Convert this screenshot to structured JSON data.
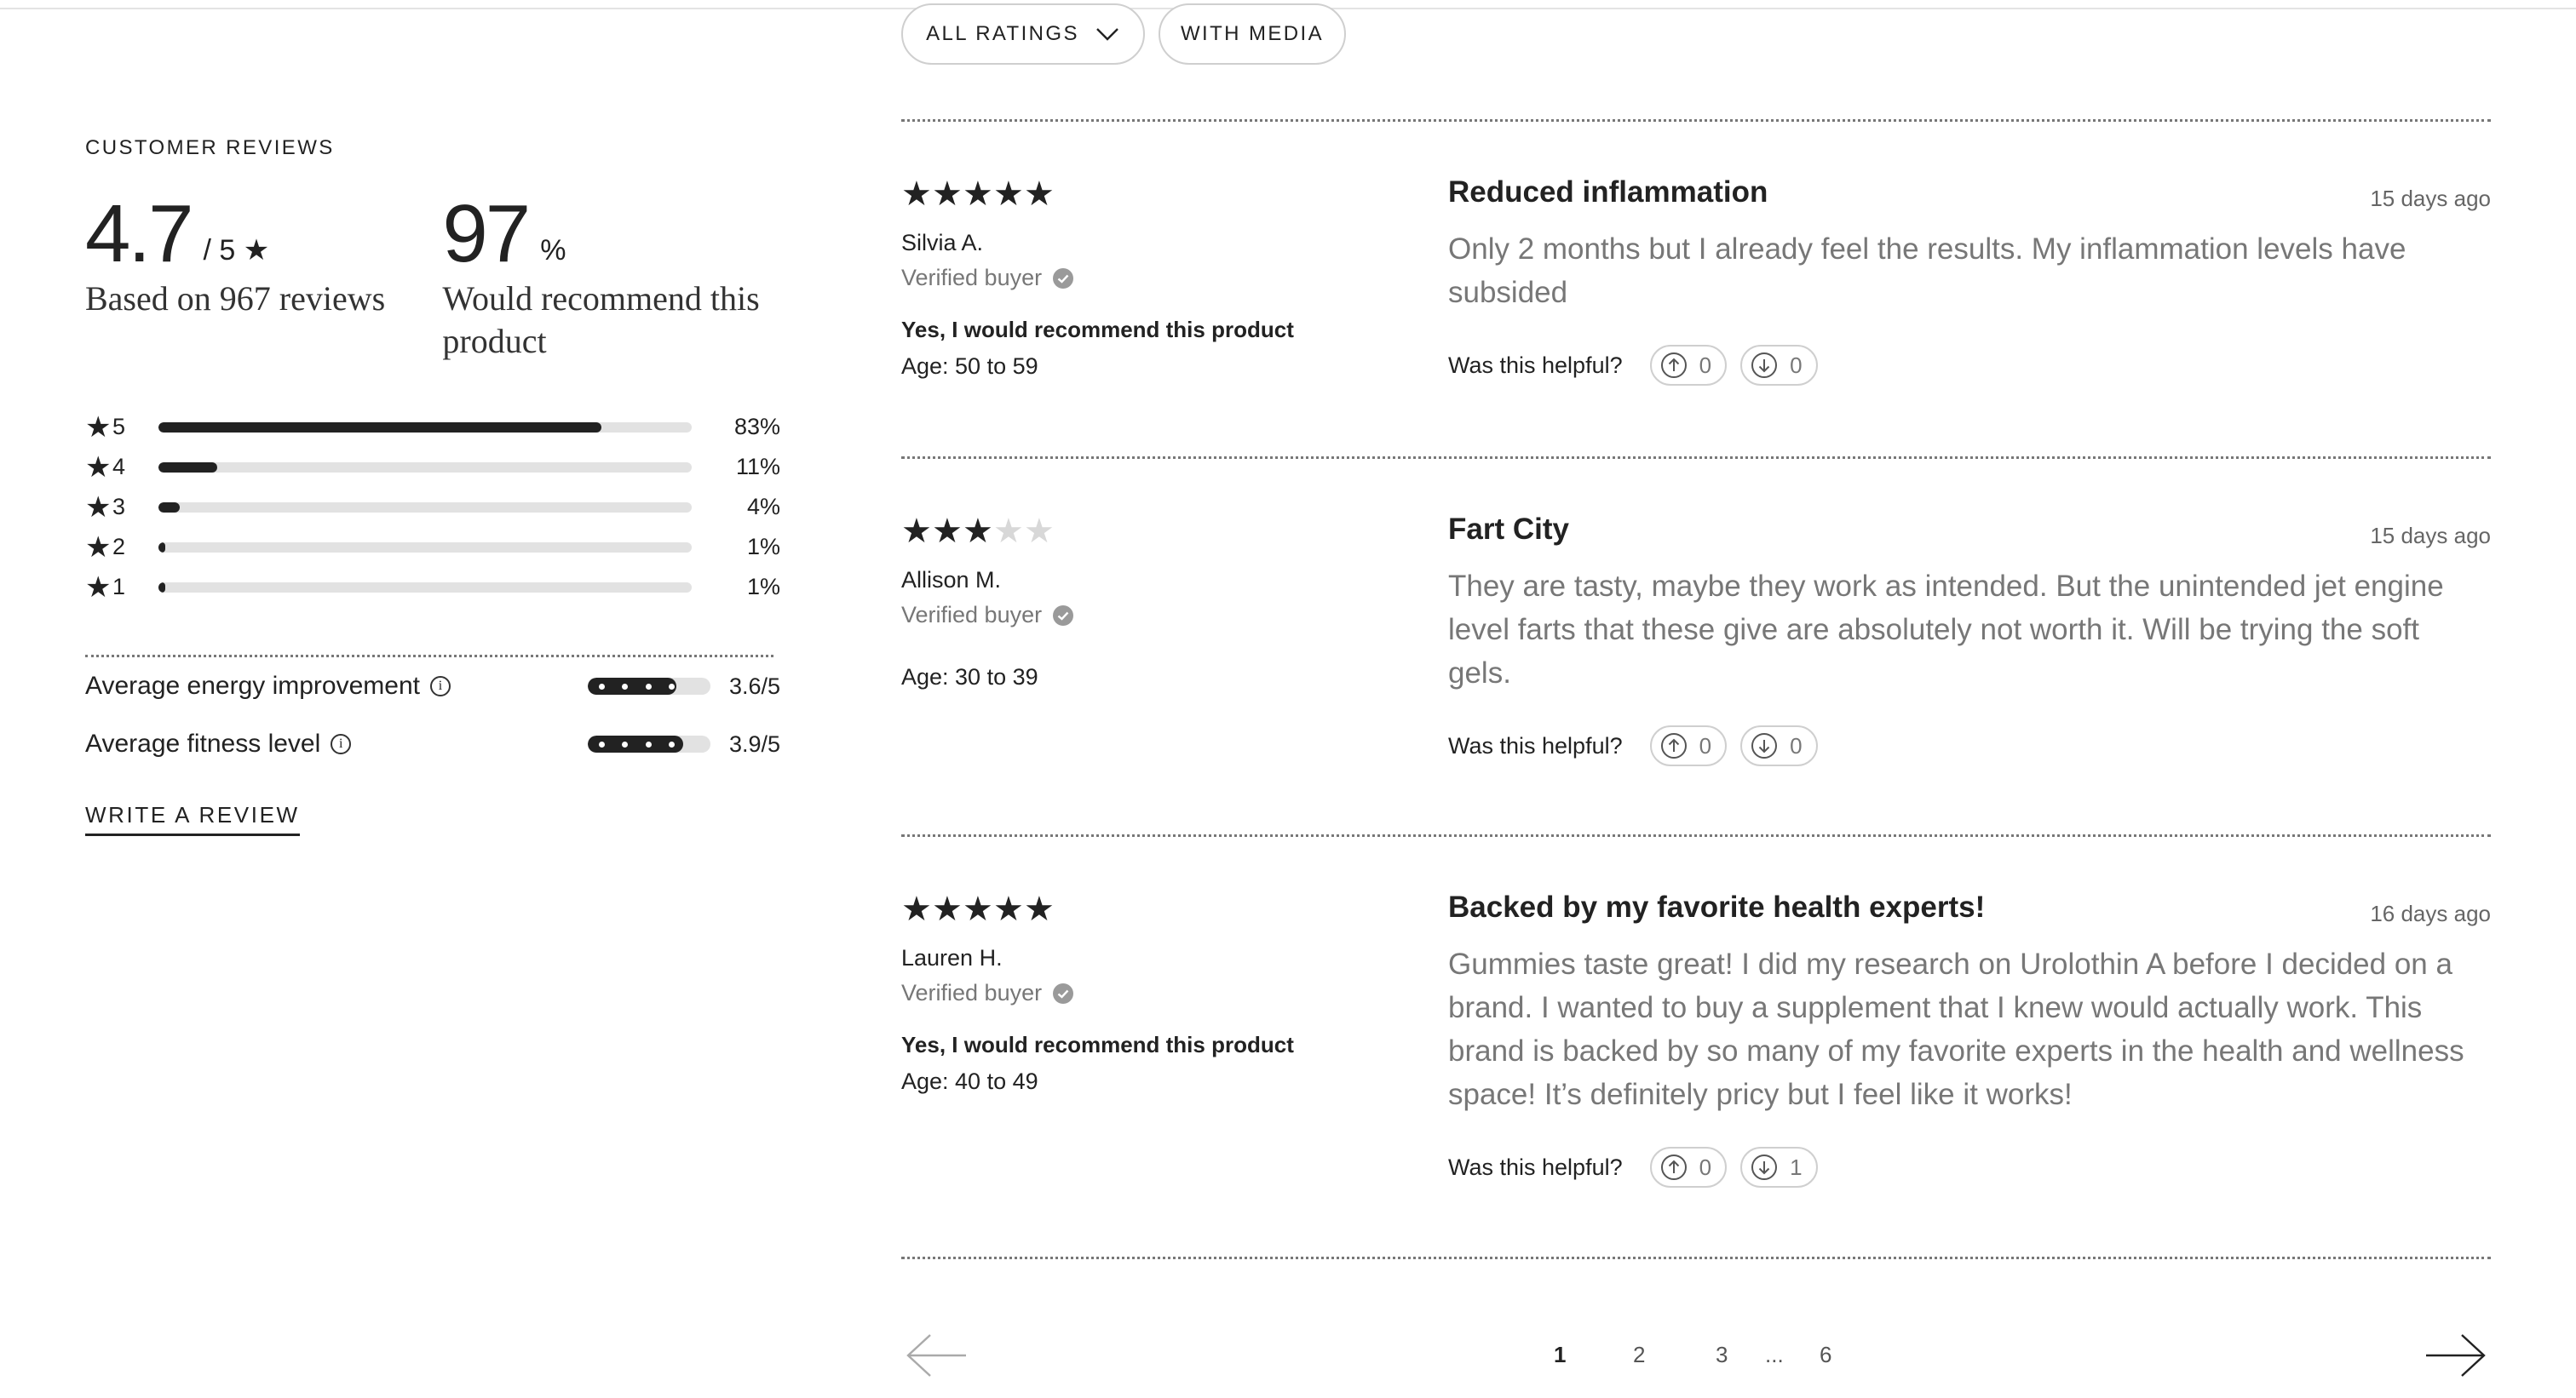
{
  "filters": {
    "all_ratings": "ALL RATINGS",
    "with_media": "WITH MEDIA"
  },
  "summary": {
    "heading": "CUSTOMER REVIEWS",
    "rating": "4.7",
    "rating_suffix": "/ 5 ★",
    "based_on": "Based on 967 reviews",
    "recommend_pct": "97",
    "recommend_suffix": "%",
    "recommend_caption": "Would recommend this product",
    "distribution": [
      {
        "star": "5",
        "pct": "83%",
        "fraction": 0.83
      },
      {
        "star": "4",
        "pct": "11%",
        "fraction": 0.11
      },
      {
        "star": "3",
        "pct": "4%",
        "fraction": 0.04
      },
      {
        "star": "2",
        "pct": "1%",
        "fraction": 0.01
      },
      {
        "star": "1",
        "pct": "1%",
        "fraction": 0.01
      }
    ],
    "averages": [
      {
        "label": "Average energy improvement",
        "value": "3.6/5",
        "score": 3.6
      },
      {
        "label": "Average fitness level",
        "value": "3.9/5",
        "score": 3.9
      }
    ],
    "write_review": "WRITE A REVIEW"
  },
  "reviews": [
    {
      "rating": 5,
      "author": "Silvia A.",
      "verified": "Verified buyer",
      "recommend": "Yes, I would recommend this product",
      "age": "Age: 50 to 59",
      "title": "Reduced inflammation",
      "date": "15 days ago",
      "body": "Only 2 months but I already feel the results. My inflammation levels have subsided",
      "helpful_label": "Was this helpful?",
      "up": "0",
      "down": "0"
    },
    {
      "rating": 3,
      "author": "Allison M.",
      "verified": "Verified buyer",
      "recommend": "",
      "age": "Age: 30 to 39",
      "title": "Fart City",
      "date": "15 days ago",
      "body": "They are tasty, maybe they work as intended. But the unintended jet engine level farts that these give are absolutely not worth it. Will be trying the soft gels.",
      "helpful_label": "Was this helpful?",
      "up": "0",
      "down": "0"
    },
    {
      "rating": 5,
      "author": "Lauren H.",
      "verified": "Verified buyer",
      "recommend": "Yes, I would recommend this product",
      "age": "Age: 40 to 49",
      "title": "Backed by my favorite health experts!",
      "date": "16 days ago",
      "body": "Gummies taste great! I did my research on Urolothin A before I decided on a brand. I wanted to buy a supplement that I knew would actually work. This brand is backed by so many of my favorite experts in the health and wellness space! It’s definitely pricy but I feel like it works!",
      "helpful_label": "Was this helpful?",
      "up": "0",
      "down": "1"
    }
  ],
  "pagination": {
    "pages": [
      "1",
      "2",
      "3",
      "6"
    ],
    "ellipsis": "...",
    "current": "1"
  }
}
